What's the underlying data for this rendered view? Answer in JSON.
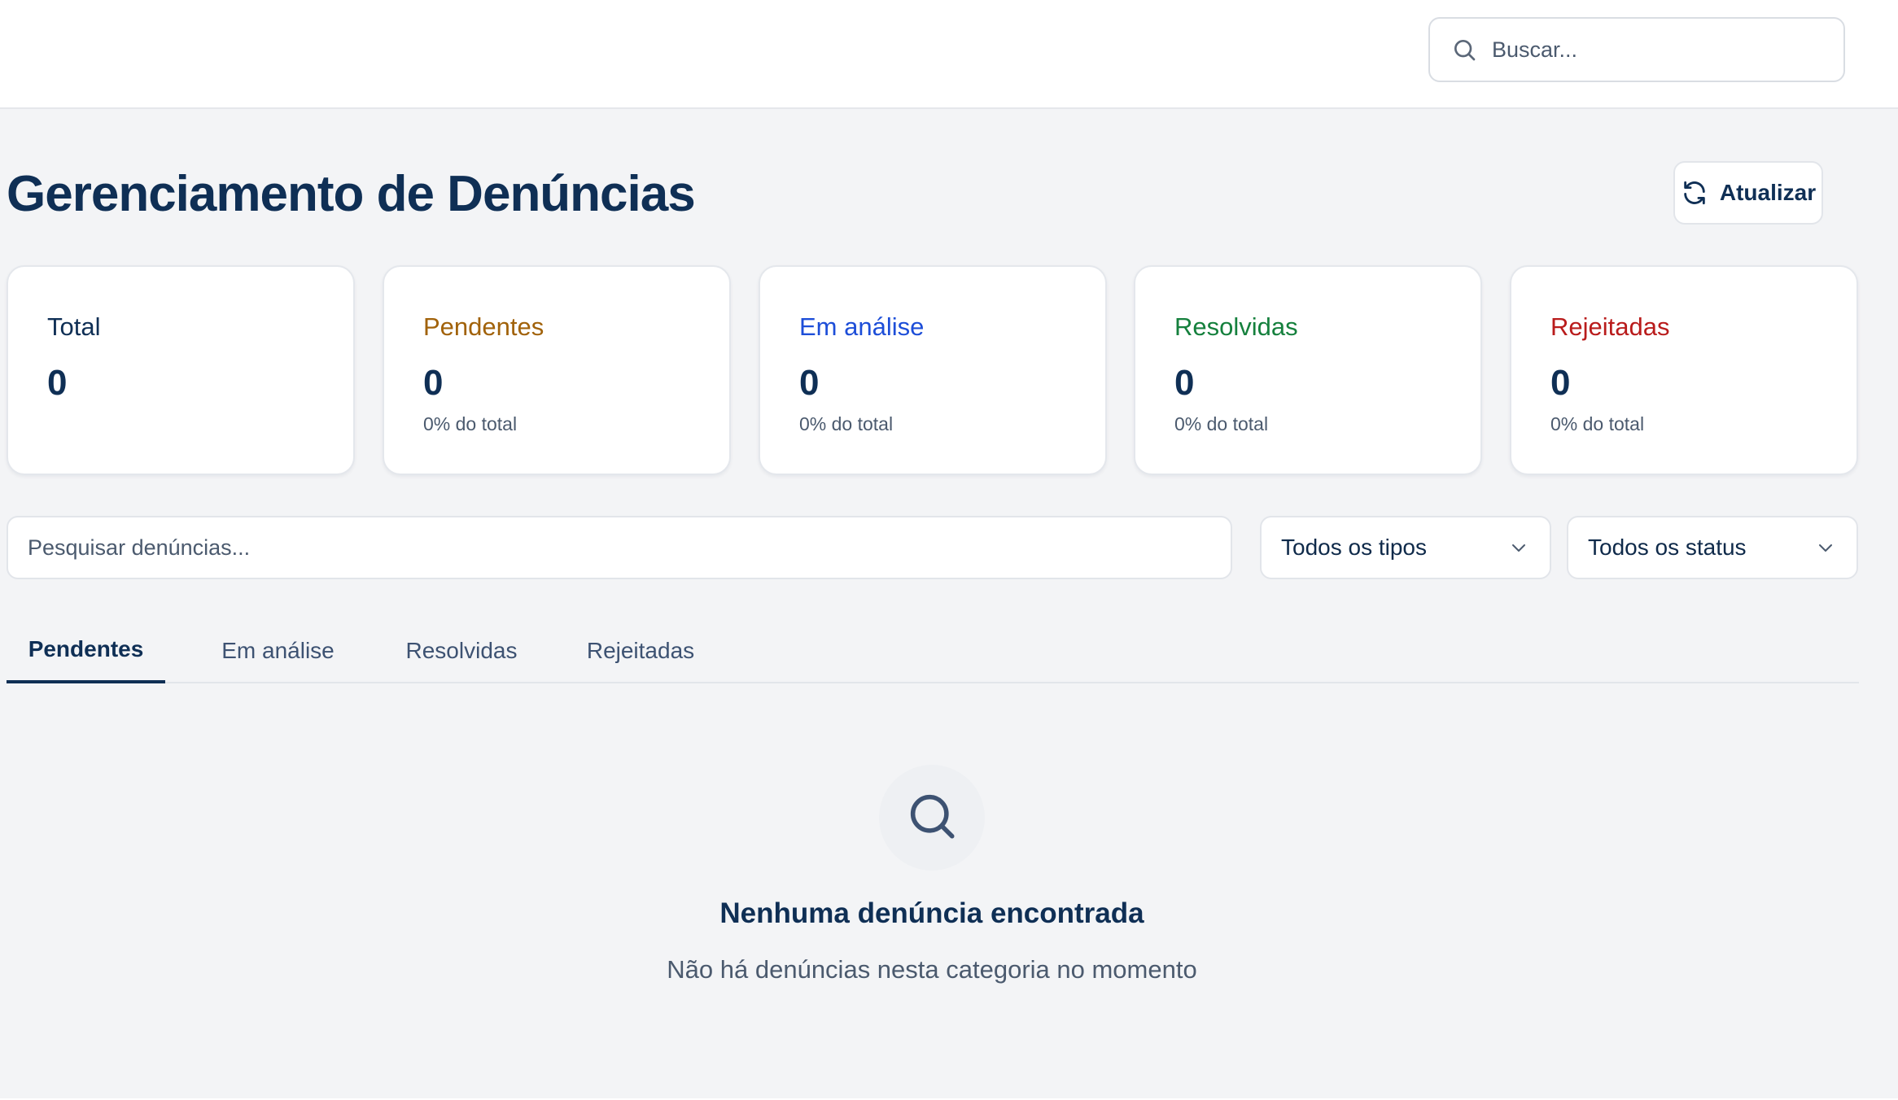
{
  "header": {
    "search_placeholder": "Buscar..."
  },
  "page": {
    "title": "Gerenciamento de Denúncias",
    "refresh_label": "Atualizar"
  },
  "stats": [
    {
      "label": "Total",
      "value": "0",
      "pct": "",
      "color": "#0f2f55"
    },
    {
      "label": "Pendentes",
      "value": "0",
      "pct": "0% do total",
      "color": "#a1620a"
    },
    {
      "label": "Em análise",
      "value": "0",
      "pct": "0% do total",
      "color": "#1d4ed8"
    },
    {
      "label": "Resolvidas",
      "value": "0",
      "pct": "0% do total",
      "color": "#15803d"
    },
    {
      "label": "Rejeitadas",
      "value": "0",
      "pct": "0% do total",
      "color": "#b91c1c"
    }
  ],
  "filters": {
    "search_placeholder": "Pesquisar denúncias...",
    "type_value": "Todos os tipos",
    "status_value": "Todos os status"
  },
  "tabs": [
    {
      "label": "Pendentes",
      "active": true
    },
    {
      "label": "Em análise",
      "active": false
    },
    {
      "label": "Resolvidas",
      "active": false
    },
    {
      "label": "Rejeitadas",
      "active": false
    }
  ],
  "empty_state": {
    "icon": "search-icon",
    "title": "Nenhuma denúncia encontrada",
    "subtitle": "Não há denúncias nesta categoria no momento"
  }
}
